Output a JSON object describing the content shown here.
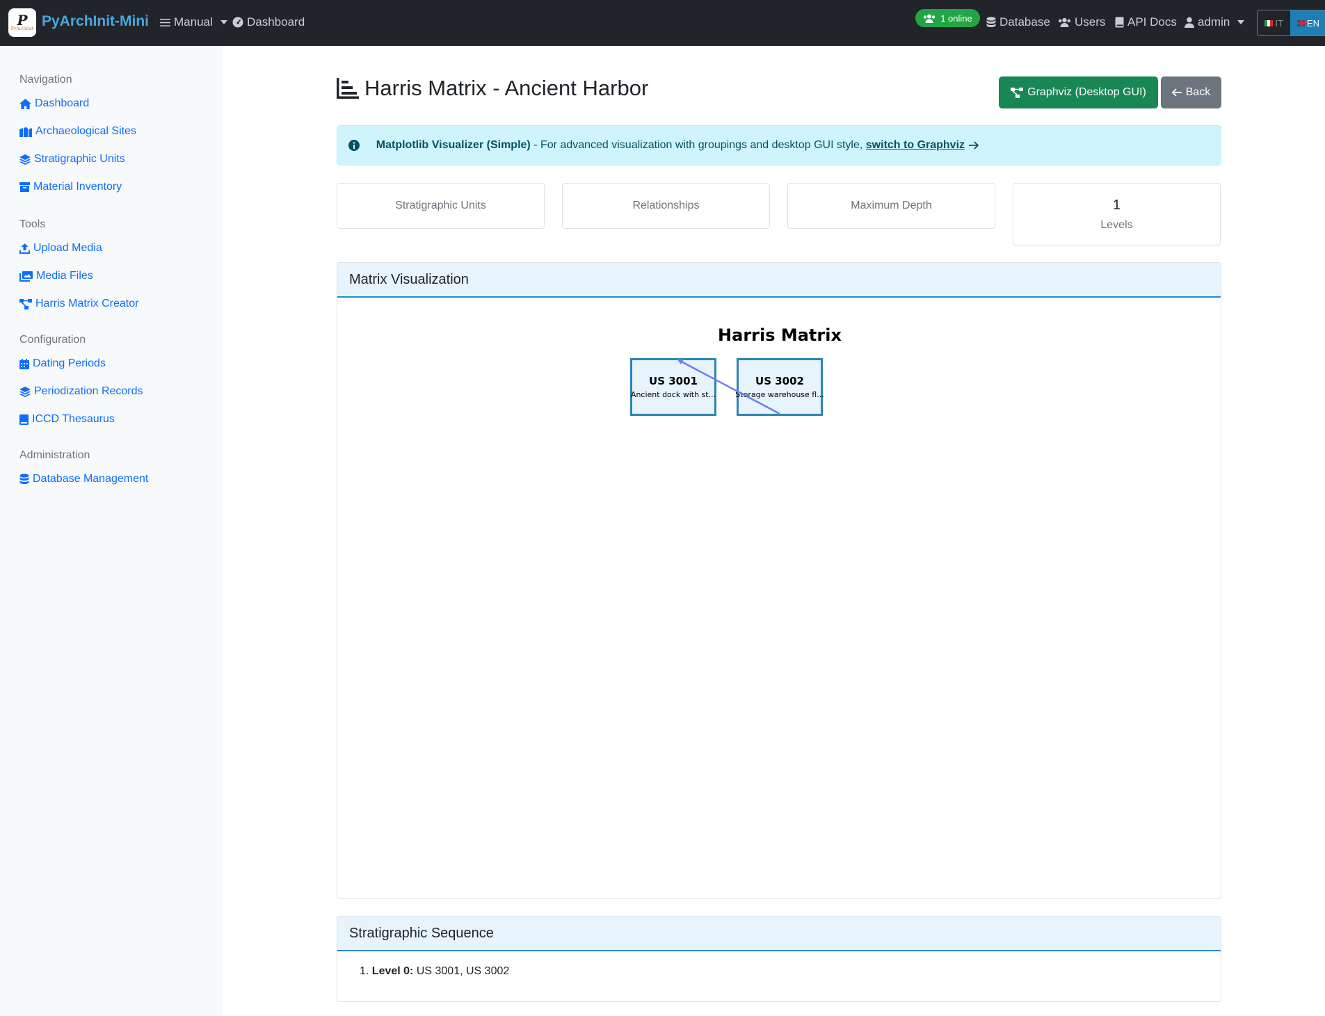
{
  "navbar": {
    "brand_logo_text": "PyArchInit",
    "brand": "PyArchInit-Mini",
    "manual": "Manual",
    "dashboard": "Dashboard",
    "online": "1 online",
    "database": "Database",
    "users": "Users",
    "api_docs": "API Docs",
    "user": "admin",
    "lang_it": "IT",
    "lang_en": "EN"
  },
  "sidebar": {
    "navigation_heading": "Navigation",
    "navigation": [
      "Dashboard",
      "Archaeological Sites",
      "Stratigraphic Units",
      "Material Inventory"
    ],
    "tools_heading": "Tools",
    "tools": [
      "Upload Media",
      "Media Files",
      "Harris Matrix Creator"
    ],
    "configuration_heading": "Configuration",
    "configuration": [
      "Dating Periods",
      "Periodization Records",
      "ICCD Thesaurus"
    ],
    "administration_heading": "Administration",
    "administration": [
      "Database Management"
    ]
  },
  "page": {
    "title": "Harris Matrix - Ancient Harbor",
    "graphviz_button": "Graphviz (Desktop GUI)",
    "back_button": "Back"
  },
  "alert": {
    "bold": "Matplotlib Visualizer (Simple)",
    "text": " - For advanced visualization with groupings and desktop GUI style, ",
    "link": "switch to Graphviz"
  },
  "stats": {
    "units_label": "Stratigraphic Units",
    "relationships_label": "Relationships",
    "depth_label": "Maximum Depth",
    "levels_value": "1",
    "levels_label": "Levels"
  },
  "visualization": {
    "header": "Matrix Visualization",
    "title": "Harris Matrix",
    "nodes": [
      {
        "id": "US 3001",
        "desc": "Ancient dock with st..."
      },
      {
        "id": "US 3002",
        "desc": "Storage warehouse fl..."
      }
    ]
  },
  "sequence": {
    "header": "Stratigraphic Sequence",
    "level_label": "Level 0:",
    "level_units": " US 3001, US 3002"
  },
  "colors": {
    "navbar": "#212529",
    "brand": "#4ba6dd",
    "link": "#0d6efd",
    "success": "#198754",
    "secondary": "#6c757d",
    "alert_bg": "#cff4fc",
    "node_border": "#2d84b4",
    "edge": "#6a7ff0"
  }
}
